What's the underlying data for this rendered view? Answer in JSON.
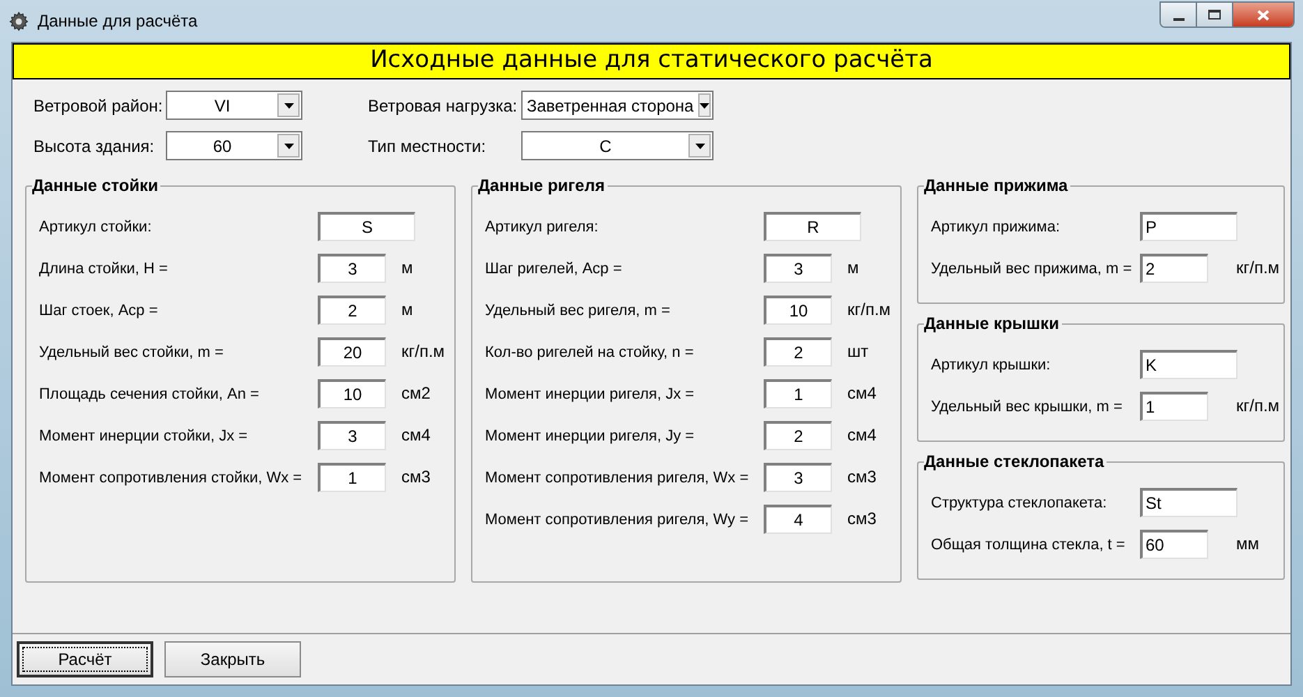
{
  "window": {
    "title": "Данные для расчёта"
  },
  "header": "Исходные данные для статического расчёта",
  "params": [
    {
      "label": "Ветровой район:",
      "value": "VI"
    },
    {
      "label": "Ветровая нагрузка:",
      "value": "Заветренная сторона"
    },
    {
      "label": "Высота здания:",
      "value": "60"
    },
    {
      "label": "Тип местности:",
      "value": "C"
    }
  ],
  "main_groups": [
    {
      "title": "Данные стойки",
      "fields": [
        {
          "label": "Артикул стойки:",
          "value": "S"
        },
        {
          "label": "Длина стойки, H =",
          "value": "3",
          "unit": "м"
        },
        {
          "label": "Шаг стоек, Acp =",
          "value": "2",
          "unit": "м"
        },
        {
          "label": "Удельный вес стойки, m =",
          "value": "20",
          "unit": "кг/п.м"
        },
        {
          "label": "Площадь сечения стойки, An =",
          "value": "10",
          "unit": "см2"
        },
        {
          "label": "Момент инерции стойки, Jx =",
          "value": "3",
          "unit": "см4"
        },
        {
          "label": "Момент сопротивления стойки, Wx =",
          "value": "1",
          "unit": "см3"
        }
      ]
    },
    {
      "title": "Данные ригеля",
      "fields": [
        {
          "label": "Артикул ригеля:",
          "value": "R"
        },
        {
          "label": "Шаг ригелей, Acp =",
          "value": "3",
          "unit": "м"
        },
        {
          "label": "Удельный вес ригеля, m =",
          "value": "10",
          "unit": "кг/п.м"
        },
        {
          "label": "Кол-во ригелей на стойку, n =",
          "value": "2",
          "unit": "шт"
        },
        {
          "label": "Момент инерции ригеля, Jx =",
          "value": "1",
          "unit": "см4"
        },
        {
          "label": "Момент инерции ригеля, Jy =",
          "value": "2",
          "unit": "см4"
        },
        {
          "label": "Момент сопротивления ригеля, Wx =",
          "value": "3",
          "unit": "см3"
        },
        {
          "label": "Момент сопротивления ригеля, Wy =",
          "value": "4",
          "unit": "см3"
        }
      ]
    }
  ],
  "side_groups": [
    {
      "title": "Данные прижима",
      "fields": [
        {
          "label": "Артикул прижима:",
          "value": "P"
        },
        {
          "label": "Удельный вес прижима, m =",
          "value": "2",
          "unit": "кг/п.м"
        }
      ]
    },
    {
      "title": "Данные крышки",
      "fields": [
        {
          "label": "Артикул крышки:",
          "value": "K"
        },
        {
          "label": "Удельный вес крышки, m =",
          "value": "1",
          "unit": "кг/п.м"
        }
      ]
    },
    {
      "title": "Данные стеклопакета",
      "fields": [
        {
          "label": "Структура стеклопакета:",
          "value": "St"
        },
        {
          "label": "Общая толщина стекла, t =",
          "value": "60",
          "unit": "мм"
        }
      ]
    }
  ],
  "buttons": [
    {
      "label": "Расчёт",
      "focused": true
    },
    {
      "label": "Закрыть",
      "focused": false
    }
  ]
}
